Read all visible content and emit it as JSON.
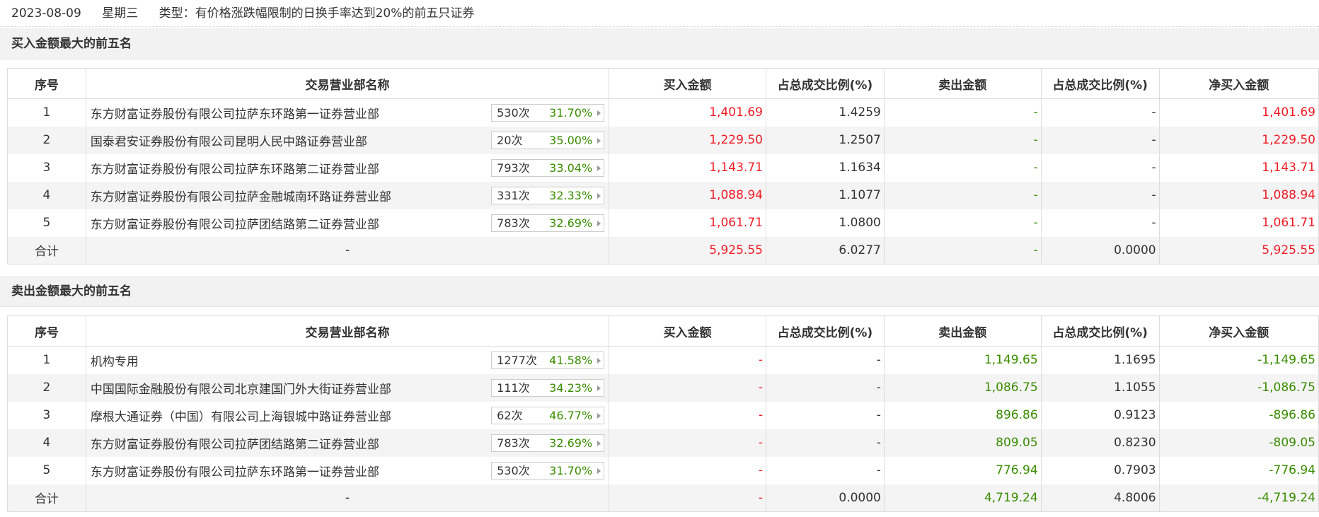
{
  "header": {
    "date": "2023-08-09",
    "weekday": "星期三",
    "type_label": "类型：有价格涨跌幅限制的日换手率达到20%的前五只证券"
  },
  "columns": [
    "序号",
    "交易营业部名称",
    "买入金额",
    "占总成交比例(%)",
    "卖出金额",
    "占总成交比例(%)",
    "净买入金额"
  ],
  "buy_top5": {
    "title": "买入金额最大的前五名",
    "rows": [
      {
        "idx": "1",
        "name": "东方财富证券股份有限公司拉萨东环路第一证券营业部",
        "count": "530次",
        "rate": "31.70%",
        "buy": "1,401.69",
        "buy_pct": "1.4259",
        "sell": "-",
        "sell_pct": "-",
        "net": "1,401.69"
      },
      {
        "idx": "2",
        "name": "国泰君安证券股份有限公司昆明人民中路证券营业部",
        "count": "20次",
        "rate": "35.00%",
        "buy": "1,229.50",
        "buy_pct": "1.2507",
        "sell": "-",
        "sell_pct": "-",
        "net": "1,229.50"
      },
      {
        "idx": "3",
        "name": "东方财富证券股份有限公司拉萨东环路第二证券营业部",
        "count": "793次",
        "rate": "33.04%",
        "buy": "1,143.71",
        "buy_pct": "1.1634",
        "sell": "-",
        "sell_pct": "-",
        "net": "1,143.71"
      },
      {
        "idx": "4",
        "name": "东方财富证券股份有限公司拉萨金融城南环路证券营业部",
        "count": "331次",
        "rate": "32.33%",
        "buy": "1,088.94",
        "buy_pct": "1.1077",
        "sell": "-",
        "sell_pct": "-",
        "net": "1,088.94"
      },
      {
        "idx": "5",
        "name": "东方财富证券股份有限公司拉萨团结路第二证券营业部",
        "count": "783次",
        "rate": "32.69%",
        "buy": "1,061.71",
        "buy_pct": "1.0800",
        "sell": "-",
        "sell_pct": "-",
        "net": "1,061.71"
      }
    ],
    "total": {
      "label": "合计",
      "name": "-",
      "buy": "5,925.55",
      "buy_pct": "6.0277",
      "sell": "-",
      "sell_pct": "0.0000",
      "net": "5,925.55"
    }
  },
  "sell_top5": {
    "title": "卖出金额最大的前五名",
    "rows": [
      {
        "idx": "1",
        "name": "机构专用",
        "count": "1277次",
        "rate": "41.58%",
        "buy": "-",
        "buy_pct": "-",
        "sell": "1,149.65",
        "sell_pct": "1.1695",
        "net": "-1,149.65"
      },
      {
        "idx": "2",
        "name": "中国国际金融股份有限公司北京建国门外大街证券营业部",
        "count": "111次",
        "rate": "34.23%",
        "buy": "-",
        "buy_pct": "-",
        "sell": "1,086.75",
        "sell_pct": "1.1055",
        "net": "-1,086.75"
      },
      {
        "idx": "3",
        "name": "摩根大通证券（中国）有限公司上海银城中路证券营业部",
        "count": "62次",
        "rate": "46.77%",
        "buy": "-",
        "buy_pct": "-",
        "sell": "896.86",
        "sell_pct": "0.9123",
        "net": "-896.86"
      },
      {
        "idx": "4",
        "name": "东方财富证券股份有限公司拉萨团结路第二证券营业部",
        "count": "783次",
        "rate": "32.69%",
        "buy": "-",
        "buy_pct": "-",
        "sell": "809.05",
        "sell_pct": "0.8230",
        "net": "-809.05"
      },
      {
        "idx": "5",
        "name": "东方财富证券股份有限公司拉萨东环路第一证券营业部",
        "count": "530次",
        "rate": "31.70%",
        "buy": "-",
        "buy_pct": "-",
        "sell": "776.94",
        "sell_pct": "0.7903",
        "net": "-776.94"
      }
    ],
    "total": {
      "label": "合计",
      "name": "-",
      "buy": "-",
      "buy_pct": "0.0000",
      "sell": "4,719.24",
      "sell_pct": "4.8006",
      "net": "-4,719.24"
    }
  },
  "colors": {
    "positive": "#ee1c25",
    "negative": "#3a8c00",
    "text": "#333333",
    "stripe": "#f4f4f4"
  }
}
